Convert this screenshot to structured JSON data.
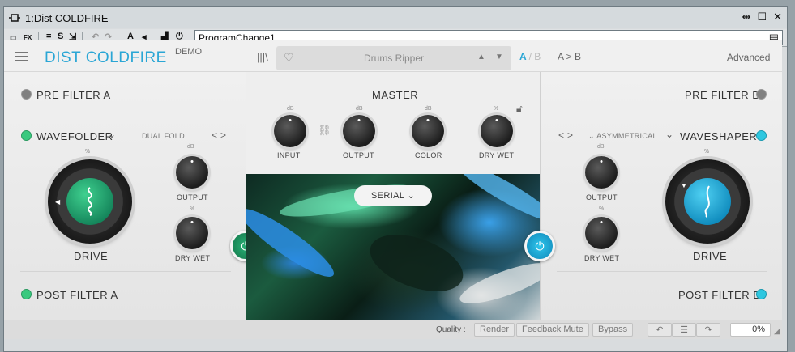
{
  "window": {
    "title": "1:Dist COLDFIRE"
  },
  "host_toolbar": {
    "preset_name": "ProgramChange1"
  },
  "plugin": {
    "brand": "DIST COLDFIRE",
    "demo_label": "DEMO",
    "preset": "Drums Ripper",
    "ab_a": "A",
    "ab_sep": "/",
    "ab_b": "B",
    "a_to_b": "A > B",
    "advanced": "Advanced"
  },
  "left": {
    "pre_filter": "PRE FILTER A",
    "module": "WAVEFOLDER",
    "mode": "DUAL FOLD",
    "nav": "< >",
    "drive_label": "DRIVE",
    "drive_unit": "%",
    "output_label": "OUTPUT",
    "output_unit": "dB",
    "drywet_label": "DRY WET",
    "drywet_unit": "%",
    "post_filter": "POST FILTER A"
  },
  "master": {
    "title": "MASTER",
    "input_label": "INPUT",
    "input_unit": "dB",
    "output_label": "OUTPUT",
    "output_unit": "dB",
    "color_label": "COLOR",
    "color_unit": "dB",
    "drywet_label": "DRY WET",
    "drywet_unit": "%",
    "routing": "SERIAL"
  },
  "right": {
    "pre_filter": "PRE FILTER B",
    "module": "WAVESHAPER",
    "mode": "ASYMMETRICAL",
    "nav": "< >",
    "drive_label": "DRIVE",
    "drive_unit": "%",
    "output_label": "OUTPUT",
    "output_unit": "dB",
    "drywet_label": "DRY WET",
    "drywet_unit": "%",
    "post_filter": "POST FILTER B"
  },
  "bottom": {
    "quality_label": "Quality :",
    "render": "Render",
    "feedback_mute": "Feedback Mute",
    "bypass": "Bypass",
    "cpu": "0%"
  },
  "colors": {
    "accent_blue": "#2aa6d5",
    "green": "#1f9e6a",
    "cyan": "#18a9d6"
  }
}
